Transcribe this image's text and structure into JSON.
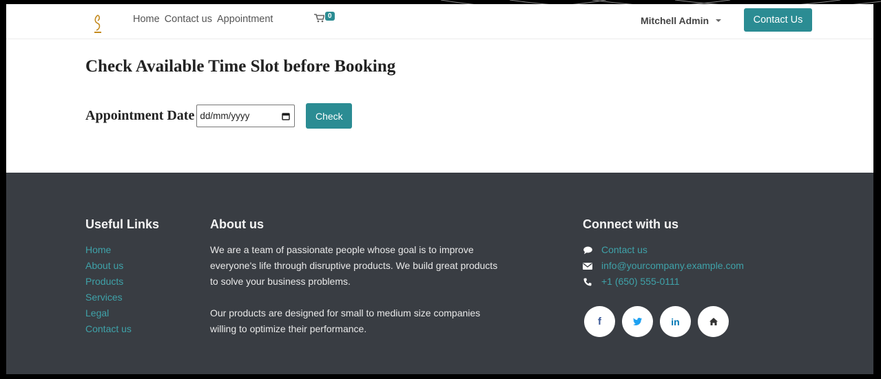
{
  "nav": {
    "links": [
      "Home",
      "Contact us",
      "Appointment"
    ],
    "cart_count": "0",
    "user_name": "Mitchell Admin",
    "contact_button": "Contact Us"
  },
  "main": {
    "title": "Check Available Time Slot before Booking",
    "date_label": "Appointment Date",
    "date_placeholder": "dd/mm/yyyy",
    "check_button": "Check"
  },
  "footer": {
    "useful_links_heading": "Useful Links",
    "useful_links": [
      "Home",
      "About us",
      "Products",
      "Services",
      "Legal",
      "Contact us"
    ],
    "about_heading": "About us",
    "about_p1": "We are a team of passionate people whose goal is to improve everyone's life through disruptive products. We build great products to solve your business problems.",
    "about_p2": "Our products are designed for small to medium size companies willing to optimize their performance.",
    "connect_heading": "Connect with us",
    "connect_items": [
      {
        "icon": "comment-icon",
        "label": "Contact us"
      },
      {
        "icon": "envelope-icon",
        "label": "info@yourcompany.example.com"
      },
      {
        "icon": "phone-icon",
        "label": "+1 (650) 555-0111"
      }
    ],
    "socials": [
      {
        "icon": "facebook-icon",
        "glyph": "f",
        "color": "#3b5998"
      },
      {
        "icon": "twitter-icon",
        "glyph": "t",
        "color": "#1da1f2"
      },
      {
        "icon": "linkedin-icon",
        "glyph": "in",
        "color": "#0077b5"
      },
      {
        "icon": "home-icon",
        "glyph": "home",
        "color": "#333333"
      }
    ]
  },
  "colors": {
    "accent": "#2b8c93",
    "link": "#3fa2a9",
    "footer_bg": "#393d43"
  }
}
